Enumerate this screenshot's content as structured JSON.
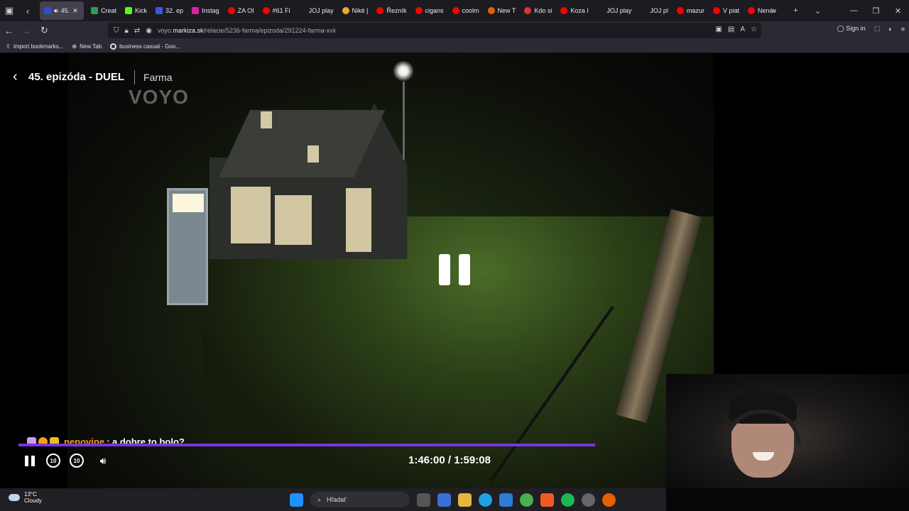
{
  "browser": {
    "tabs": [
      {
        "label": "45.",
        "active": true,
        "color": "#3050c8"
      },
      {
        "label": "Creat",
        "color": "#2e9e4e"
      },
      {
        "label": "Kick",
        "color": "#53fc18"
      },
      {
        "label": "32. ep",
        "color": "#3a5bd9"
      },
      {
        "label": "Instag",
        "color": "#d6249f"
      },
      {
        "label": "ZA OI",
        "color": "#ff0000"
      },
      {
        "label": "#61 Fi",
        "color": "#ff0000"
      },
      {
        "label": "JOJ play",
        "color": "#1c1b22"
      },
      {
        "label": "Niké |",
        "color": "#f5a623"
      },
      {
        "label": "Řezník",
        "color": "#ff0000"
      },
      {
        "label": "cigans",
        "color": "#ff0000"
      },
      {
        "label": "coolm",
        "color": "#ff0000"
      },
      {
        "label": "New T",
        "color": "#e66000"
      },
      {
        "label": "Kdo si",
        "color": "#d33"
      },
      {
        "label": "Koza l",
        "color": "#ff0000"
      },
      {
        "label": "JOJ play",
        "color": "#1c1b22"
      },
      {
        "label": "JOJ pl",
        "color": "#1c1b22"
      },
      {
        "label": "mazur",
        "color": "#ff0000"
      },
      {
        "label": "V piat",
        "color": "#ff0000"
      },
      {
        "label": "Nenáv",
        "color": "#ff0000"
      }
    ],
    "url_prefix": "voyo.",
    "url_domain": "markiza.sk",
    "url_path": "/relacie/5236-farma/epizoda/291224-farma-xvii",
    "sign_in": "Sign in",
    "bookmarks": [
      "Import bookmarks...",
      "New Tab",
      "business casual - Goo..."
    ]
  },
  "player": {
    "episode_title": "45. epizóda - DUEL",
    "show_name": "Farma",
    "logo_text": "VOYO",
    "time_display": "1:46:00 / 1:59:08",
    "progress_fraction": 0.89,
    "skip_back": "10",
    "skip_forward": "10"
  },
  "chat": {
    "username": "nepovine",
    "message": ": a dobre to bolo?"
  },
  "taskbar": {
    "temperature": "13°C",
    "condition": "Cloudy",
    "search_placeholder": "Hľadať"
  },
  "colors": {
    "progress": "#7b33e0",
    "chat_user": "#f0a020"
  }
}
